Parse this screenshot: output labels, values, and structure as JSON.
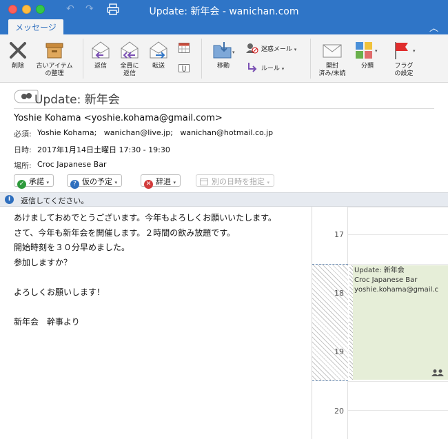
{
  "window": {
    "title": "Update: 新年会 - wanichan.com"
  },
  "tabs": {
    "active": "メッセージ"
  },
  "ribbon": {
    "delete": "削除",
    "archive_1": "古いアイテム",
    "archive_2": "の整理",
    "reply": "返信",
    "reply_all_1": "全員に",
    "reply_all_2": "返信",
    "forward": "転送",
    "move": "移動",
    "junk": "迷惑メール",
    "rules": "ルール",
    "read_1": "開封",
    "read_2": "済み/未読",
    "categorize": "分類",
    "flag_1": "フラグ",
    "flag_2": "の設定"
  },
  "message": {
    "subject": "Update: 新年会",
    "sender": "Yoshie Kohama <yoshie.kohama@gmail.com>",
    "required_label": "必須:",
    "required_value": "Yoshie Kohama;   wanichan@live.jp;   wanichan@hotmail.co.jp",
    "when_label": "日時:",
    "when_value": "2017年1月14日土曜日 17:30 - 19:30",
    "where_label": "場所:",
    "where_value": "Croc Japanese Bar"
  },
  "rsvp": {
    "accept": "承諾",
    "tentative": "仮の予定",
    "decline": "辞退",
    "propose": "別の日時を指定"
  },
  "info": {
    "text": "返信してください。"
  },
  "body": {
    "lines": [
      "あけましておめでとうございます。今年もよろしくお願いいたします。",
      "さて、今年も新年会を開催します。２時間の飲み放題です。",
      "開始時刻を３０分早めました。",
      "参加しますか？",
      "",
      "よろしくお願いします！",
      "",
      "新年会　幹事より"
    ]
  },
  "calendar": {
    "hours": [
      "17",
      "18",
      "19",
      "20"
    ],
    "event": {
      "title": "Update: 新年会",
      "location": "Croc Japanese Bar",
      "organizer": "yoshie.kohama@gmail.c"
    }
  },
  "colors": {
    "titlebar": "#2f75c7",
    "event_fill": "#e6eed8",
    "accept": "#2e9a3c",
    "tentative": "#2f6fbe",
    "decline": "#d23b3b"
  },
  "icons": {
    "delete": "x-icon",
    "archive": "archive-box-icon",
    "reply": "envelope-reply-icon",
    "flag": "red-flag-icon"
  }
}
